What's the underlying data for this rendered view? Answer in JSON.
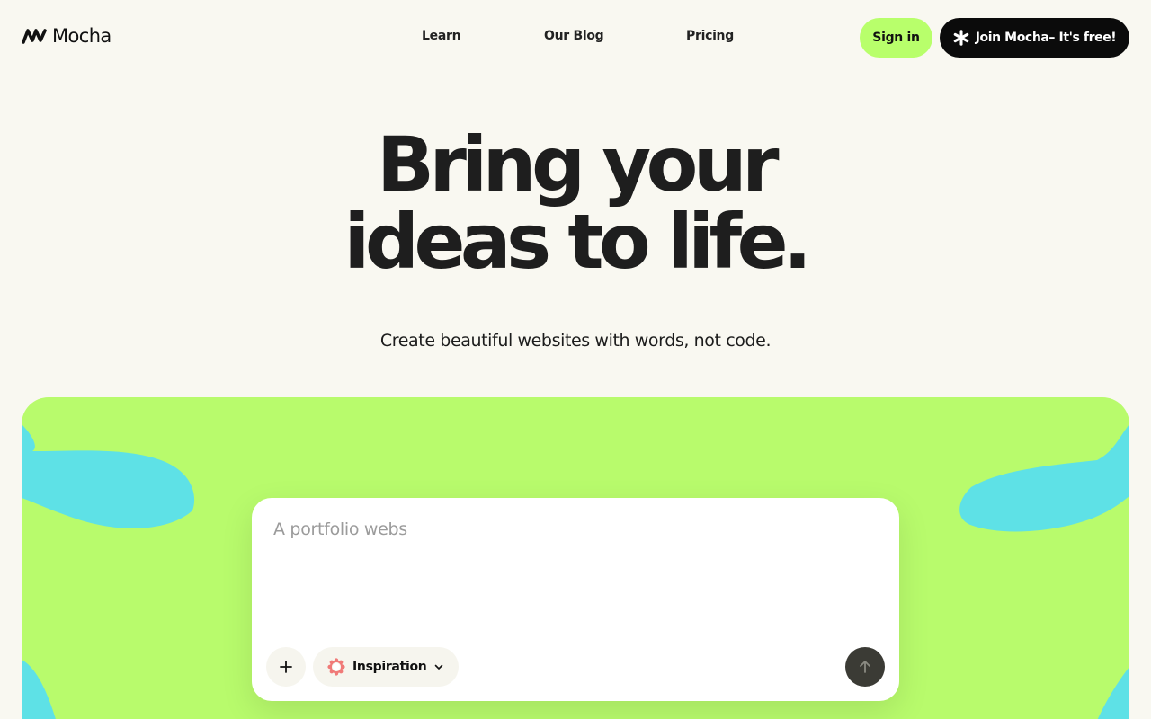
{
  "brand": {
    "name": "Mocha",
    "logo_icon": "mocha-wave-icon"
  },
  "nav": {
    "links": [
      {
        "label": "Learn"
      },
      {
        "label": "Our Blog"
      },
      {
        "label": "Pricing"
      }
    ],
    "sign_in": "Sign in",
    "join": "Join Mocha– It's free!",
    "join_icon": "asterisk-icon"
  },
  "hero": {
    "title_line1": "Bring your",
    "title_line2": "ideas to life.",
    "subtitle": "Create beautiful websites with words, not code."
  },
  "prompt": {
    "placeholder": "A portfolio webs",
    "add_icon": "plus-icon",
    "inspiration_label": "Inspiration",
    "inspiration_icon": "flower-icon",
    "send_icon": "arrow-up-icon"
  },
  "colors": {
    "background": "#f9f8f1",
    "accent_green": "#b8ff6b",
    "panel_green": "#b8fb6c",
    "blob_cyan": "#5ee1e6",
    "dark": "#0b0b0b",
    "flower": "#f07a78"
  }
}
